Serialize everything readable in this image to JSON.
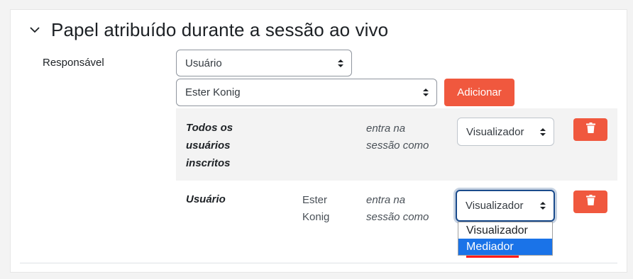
{
  "section": {
    "title": "Papel atribuído durante a sessão ao vivo",
    "collapse_icon": "chevron-down-icon"
  },
  "form": {
    "responsible_label": "Responsável",
    "type_select": {
      "value": "Usuário",
      "icon": "sort-arrows-icon"
    },
    "user_select": {
      "value": "Ester Konig",
      "icon": "sort-arrows-icon"
    },
    "add_button": "Adicionar"
  },
  "rows": [
    {
      "who_lines": [
        "Todos os",
        "usuários",
        "inscritos"
      ],
      "name_lines": [],
      "role_text_lines": [
        "entra na",
        "sessão como"
      ],
      "role_select": "Visualizador",
      "delete_icon": "trash-icon"
    },
    {
      "who_lines": [
        "Usuário"
      ],
      "name_lines": [
        "Ester",
        "Konig"
      ],
      "role_text_lines": [
        "entra na",
        "sessão como"
      ],
      "role_select": "Visualizador",
      "delete_icon": "trash-icon"
    }
  ],
  "dropdown": {
    "options": [
      "Visualizador",
      "Mediador"
    ],
    "highlighted": "Mediador"
  },
  "colors": {
    "accent": "#f0583e",
    "focus_border": "#1a4b8c",
    "highlight": "#1a73e8",
    "annotation_underline": "#ff1a1a",
    "row_shade": "#f3f3f3"
  }
}
